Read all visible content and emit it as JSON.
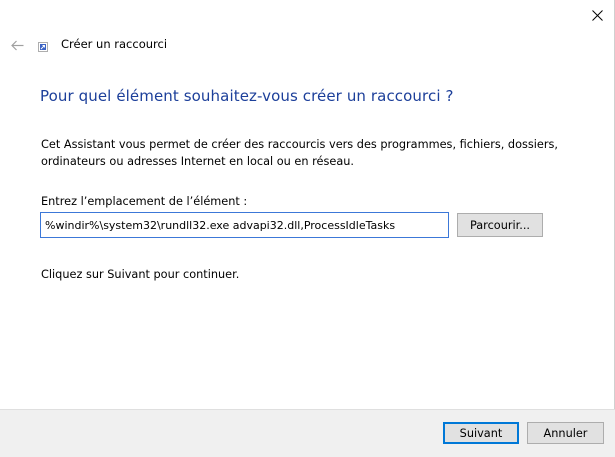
{
  "window": {
    "title": "Créer un raccourci"
  },
  "page": {
    "heading": "Pour quel élément souhaitez-vous créer un raccourci ?",
    "description": "Cet Assistant vous permet de créer des raccourcis vers des programmes, fichiers, dossiers, ordinateurs ou adresses Internet en local ou en réseau.",
    "field_label": "Entrez l’emplacement de l’élément :",
    "location_value": "%windir%\\system32\\rundll32.exe advapi32.dll,ProcessIdleTasks",
    "browse_label": "Parcourir...",
    "hint": "Cliquez sur Suivant pour continuer."
  },
  "footer": {
    "next_label": "Suivant",
    "cancel_label": "Annuler"
  },
  "icons": {
    "close": "close-icon",
    "back": "back-arrow-icon",
    "shortcut": "shortcut-icon"
  },
  "colors": {
    "heading": "#1c3f9a",
    "input_border": "#3c78d8",
    "default_button_border": "#0078d7",
    "footer_bg": "#f0f0f0"
  }
}
